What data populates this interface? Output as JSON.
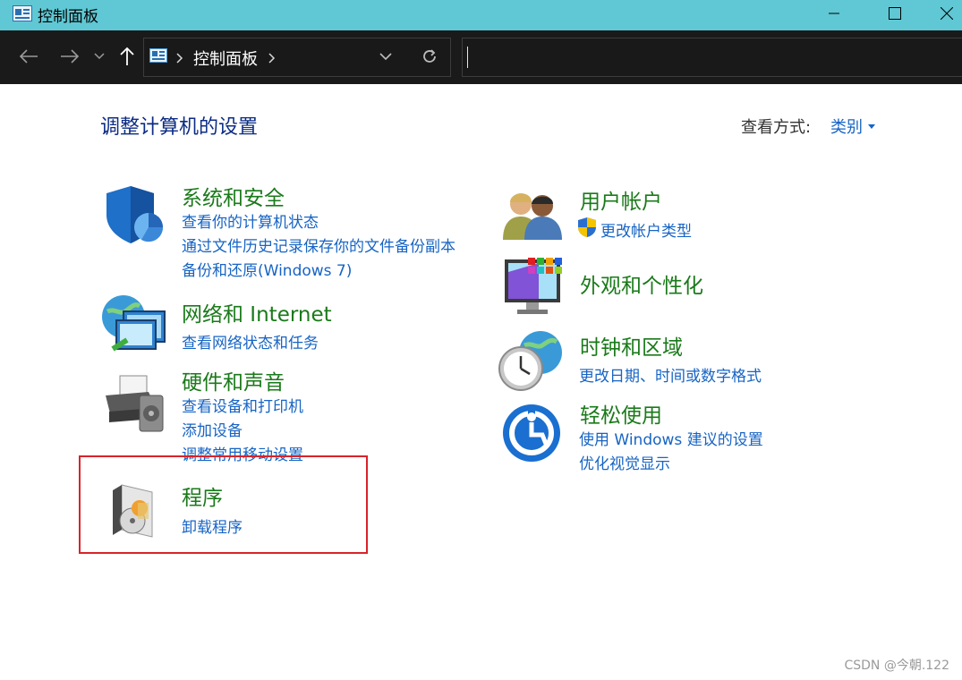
{
  "window": {
    "title": "控制面板"
  },
  "nav": {
    "breadcrumb": "控制面板",
    "search_placeholder": ""
  },
  "main": {
    "heading": "调整计算机的设置",
    "view_by_label": "查看方式:",
    "view_by_value": "类别"
  },
  "categories": {
    "system_security": {
      "title": "系统和安全",
      "links": [
        "查看你的计算机状态",
        "通过文件历史记录保存你的文件备份副本",
        "备份和还原(Windows 7)"
      ]
    },
    "network": {
      "title": "网络和 Internet",
      "links": [
        "查看网络状态和任务"
      ]
    },
    "hardware": {
      "title": "硬件和声音",
      "links": [
        "查看设备和打印机",
        "添加设备",
        "调整常用移动设置"
      ]
    },
    "programs": {
      "title": "程序",
      "links": [
        "卸载程序"
      ]
    },
    "user_accounts": {
      "title": "用户帐户",
      "links": [
        "更改帐户类型"
      ]
    },
    "appearance": {
      "title": "外观和个性化",
      "links": []
    },
    "clock_region": {
      "title": "时钟和区域",
      "links": [
        "更改日期、时间或数字格式"
      ]
    },
    "ease_of_access": {
      "title": "轻松使用",
      "links": [
        "使用 Windows 建议的设置",
        "优化视觉显示"
      ]
    }
  },
  "watermark": "CSDN @今朝.122",
  "colors": {
    "titlebar": "#5fc8d4",
    "navbar": "#1a1a1a",
    "heading": "#0c2c84",
    "category_title": "#1a7a1a",
    "link": "#1764c4",
    "highlight": "#d9232a"
  }
}
